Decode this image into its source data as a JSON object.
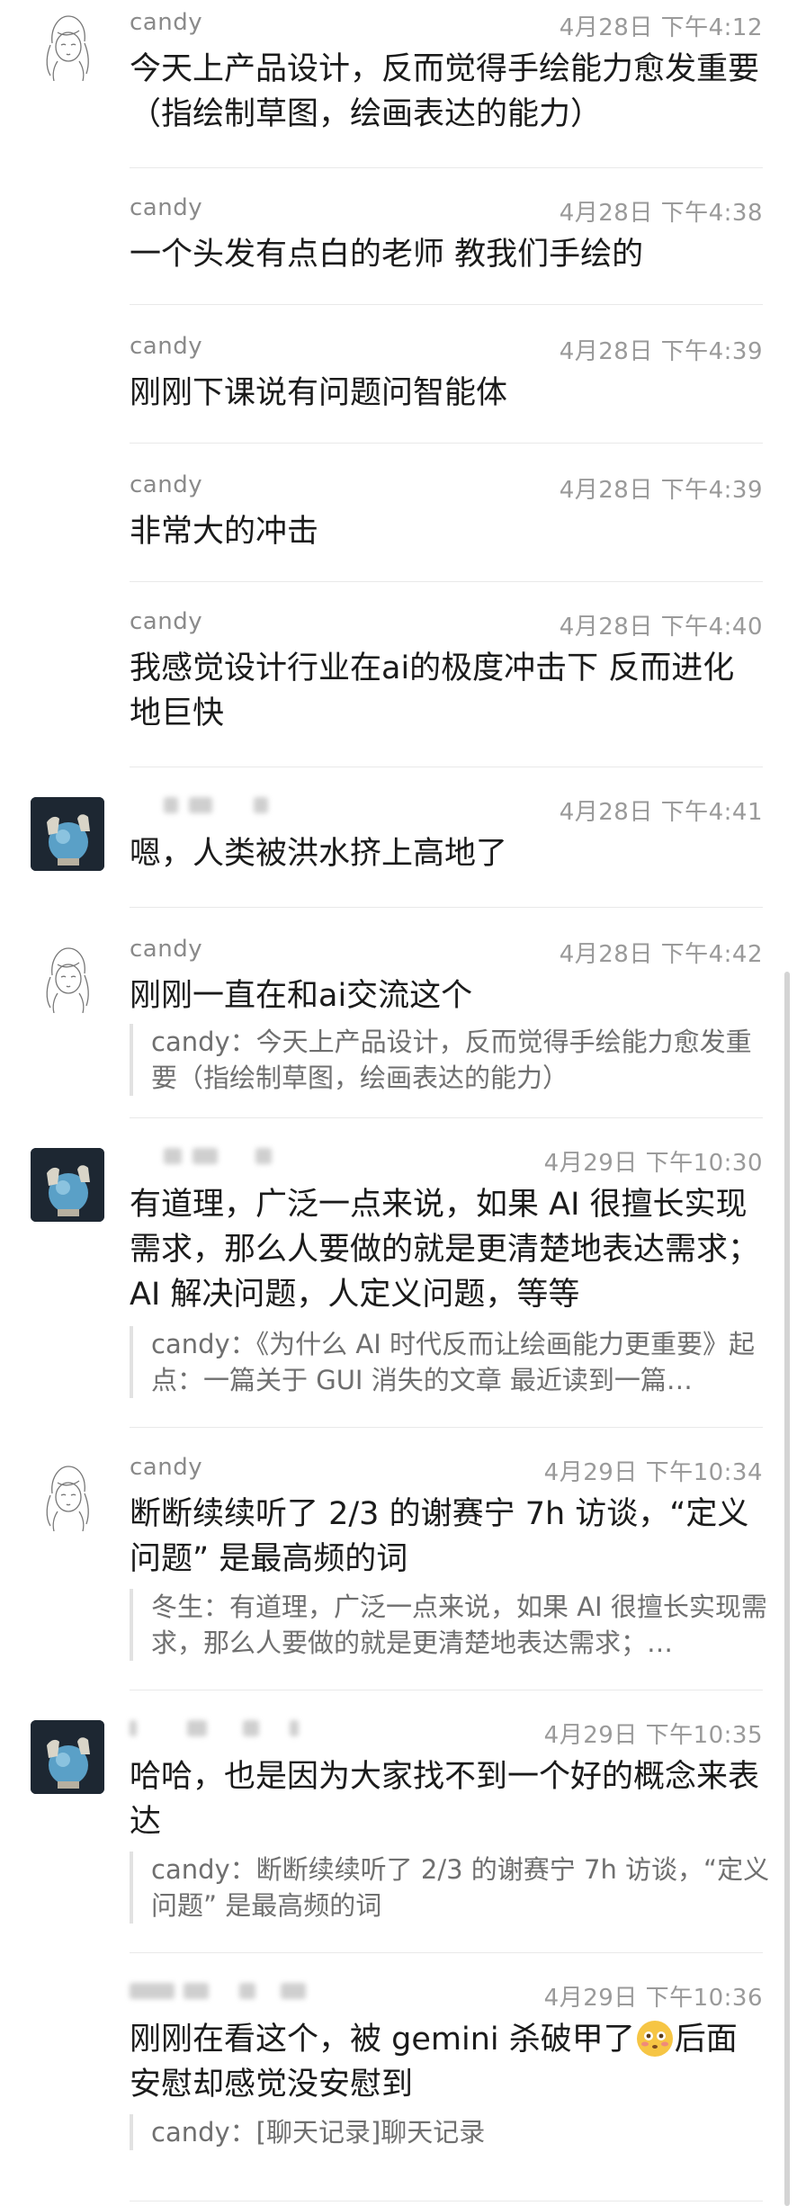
{
  "messages": [
    {
      "sender": "candy",
      "time": "4月28日 下午4:12",
      "text": "今天上产品设计，反而觉得手绘能力愈发重要（指绘制草图，绘画表达的能力）"
    },
    {
      "sender": "candy",
      "time": "4月28日 下午4:38",
      "text": "一个头发有点白的老师 教我们手绘的"
    },
    {
      "sender": "candy",
      "time": "4月28日 下午4:39",
      "text": "刚刚下课说有问题问智能体"
    },
    {
      "sender": "candy",
      "time": "4月28日 下午4:39",
      "text": "非常大的冲击"
    },
    {
      "sender": "candy",
      "time": "4月28日 下午4:40",
      "text": "我感觉设计行业在ai的极度冲击下 反而进化地巨快"
    },
    {
      "sender": "",
      "time": "4月28日 下午4:41",
      "text": "嗯，人类被洪水挤上高地了"
    },
    {
      "sender": "candy",
      "time": "4月28日 下午4:42",
      "text": "刚刚一直在和ai交流这个",
      "quote": "candy：今天上产品设计，反而觉得手绘能力愈发重要（指绘制草图，绘画表达的能力）"
    },
    {
      "sender": "",
      "time": "4月29日 下午10:30",
      "text": "有道理，广泛一点来说，如果 AI 很擅长实现需求，那么人要做的就是更清楚地表达需求；AI 解决问题，人定义问题，等等",
      "quote": "candy：《为什么 AI 时代反而让绘画能力更重要》起点：一篇关于 GUI 消失的文章 最近读到一篇…"
    },
    {
      "sender": "candy",
      "time": "4月29日 下午10:34",
      "text": "断断续续听了 2/3 的谢赛宁 7h 访谈，“定义问题” 是最高频的词",
      "quote": "冬生：有道理，广泛一点来说，如果 AI 很擅长实现需求，那么人要做的就是更清楚地表达需求；…"
    },
    {
      "sender": "",
      "time": "4月29日 下午10:35",
      "text": "哈哈，也是因为大家找不到一个好的概念来表达",
      "quote": "candy：断断续续听了 2/3 的谢赛宁 7h 访谈，“定义问题” 是最高频的词"
    },
    {
      "sender": "",
      "time": "4月29日 下午10:36",
      "text_before": "刚刚在看这个，被 gemini 杀破甲了",
      "text_after": "后面安慰却感觉没安慰到",
      "quote": "candy：[聊天记录]聊天记录"
    }
  ],
  "colors": {
    "text": "#1b1b1b",
    "meta": "#9a9a9a",
    "quote": "#6f6f6f",
    "emoji": "#f6c544"
  },
  "icons": [
    "sketch-girl-avatar",
    "globe-photo-avatar",
    "flushed-face-emoji"
  ]
}
